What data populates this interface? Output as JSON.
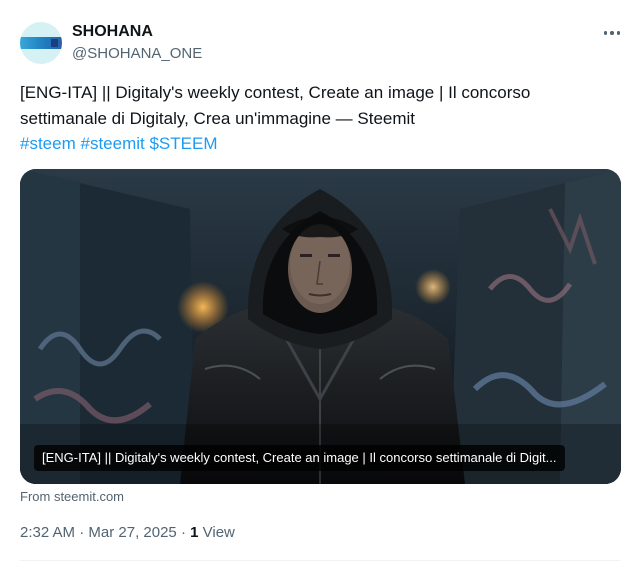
{
  "author": {
    "display_name": "SHOHANA",
    "handle": "@SHOHANA_ONE"
  },
  "tweet": {
    "text_line1": "[ENG-ITA] || Digitaly's weekly contest, Create an image  | Il concorso",
    "text_line2": "settimanale di Digitaly, Crea un'immagine — Steemit",
    "hashtags": [
      "#steem",
      "#steemit",
      "$STEEM"
    ]
  },
  "media": {
    "caption": "[ENG-ITA] || Digitaly's weekly contest, Create an image | Il concorso settimanale di Digit...",
    "source": "From steemit.com"
  },
  "meta": {
    "time": "2:32 AM",
    "separator": "·",
    "date": "Mar 27, 2025",
    "views_count": "1",
    "views_label": "View"
  },
  "colors": {
    "link": "#1d9bf0",
    "text": "#0f1419",
    "secondary": "#536471"
  },
  "icons": {
    "more": "ellipsis-icon"
  }
}
